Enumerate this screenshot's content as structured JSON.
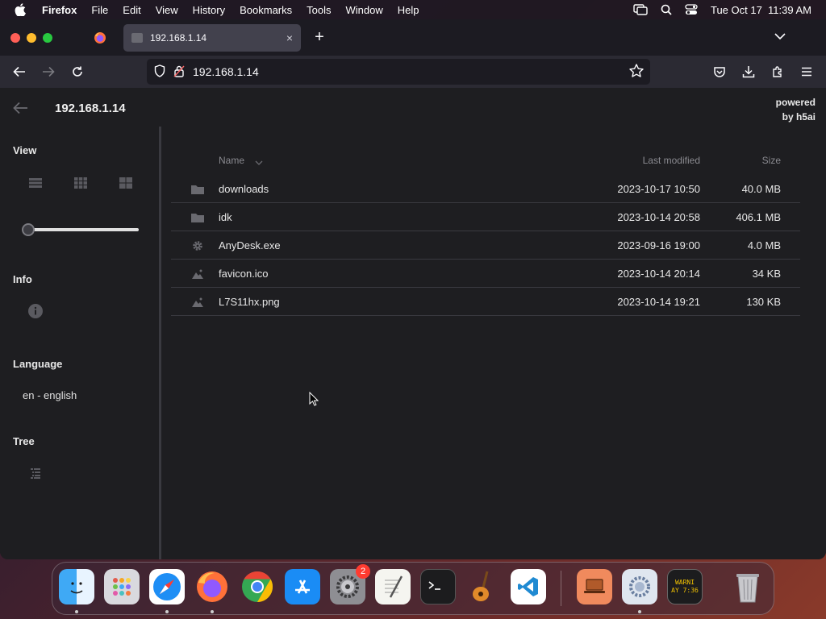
{
  "menubar": {
    "app_name": "Firefox",
    "items": [
      "File",
      "Edit",
      "View",
      "History",
      "Bookmarks",
      "Tools",
      "Window",
      "Help"
    ],
    "clock": "Tue Oct 17  11:39 AM"
  },
  "browser": {
    "tab_title": "192.168.1.14",
    "tab_close": "×",
    "new_tab": "+",
    "url": "192.168.1.14"
  },
  "page": {
    "title": "192.168.1.14",
    "powered_line1": "powered",
    "powered_line2": "by h5ai",
    "sidebar": {
      "view_heading": "View",
      "info_heading": "Info",
      "language_heading": "Language",
      "language_value": "en - english",
      "tree_heading": "Tree",
      "size_slider_value": 0
    },
    "columns": {
      "name": "Name",
      "modified": "Last modified",
      "size": "Size"
    },
    "files": [
      {
        "icon": "folder-icon",
        "name": "downloads",
        "modified": "2023-10-17 10:50",
        "size": "40.0 MB"
      },
      {
        "icon": "folder-icon",
        "name": "idk",
        "modified": "2023-10-14 20:58",
        "size": "406.1 MB"
      },
      {
        "icon": "gear-icon",
        "name": "AnyDesk.exe",
        "modified": "2023-09-16 19:00",
        "size": "4.0 MB"
      },
      {
        "icon": "image-icon",
        "name": "favicon.ico",
        "modified": "2023-10-14 20:14",
        "size": "34 KB"
      },
      {
        "icon": "image-icon",
        "name": "L7S11hx.png",
        "modified": "2023-10-14 19:21",
        "size": "130 KB"
      }
    ]
  },
  "dock": {
    "apps": [
      "Finder",
      "Launchpad",
      "Safari",
      "Firefox",
      "Chrome",
      "App Store",
      "System Settings",
      "TextEdit",
      "Terminal",
      "GarageBand",
      "Visual Studio Code",
      "Screen Sharing",
      "Network Utility",
      "Console",
      "Trash"
    ],
    "settings_badge": "2",
    "console_text_line1": "WARNI",
    "console_text_line2": "AY 7:36"
  },
  "colors": {
    "page_bg": "#1e1e21",
    "tab_active": "#42414d",
    "toolbar": "#2b2a33"
  }
}
